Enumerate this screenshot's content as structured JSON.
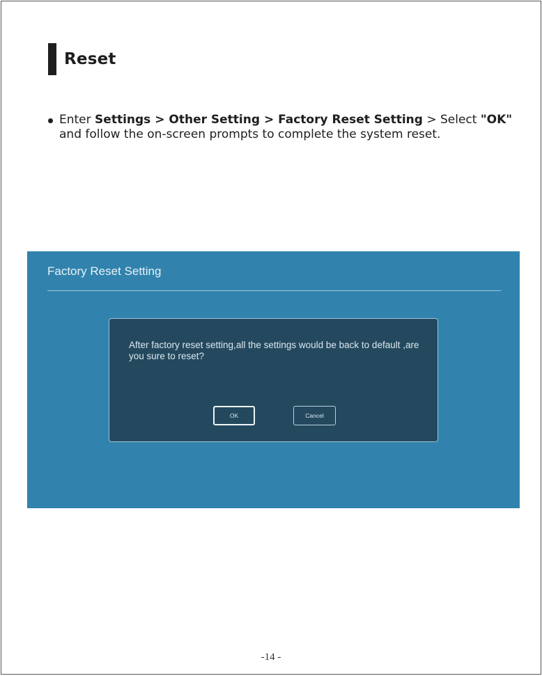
{
  "section": {
    "title": "Reset"
  },
  "instruction": {
    "part1": "Enter ",
    "settings": "Settings",
    "sep1": " > ",
    "other_setting": "Other Setting",
    "sep2": " > ",
    "factory_reset_setting": "Factory Reset Setting",
    "sep3": " > Select ",
    "ok_quoted": "\"OK\"",
    "part2": " and follow the on-screen prompts to complete the system reset."
  },
  "screenshot": {
    "title": "Factory Reset Setting",
    "dialog_message": "After factory reset setting,all the settings would be back to default ,are you sure to reset?",
    "ok_label": "OK",
    "cancel_label": "Cancel"
  },
  "footer": {
    "page_number": "-14 -"
  }
}
